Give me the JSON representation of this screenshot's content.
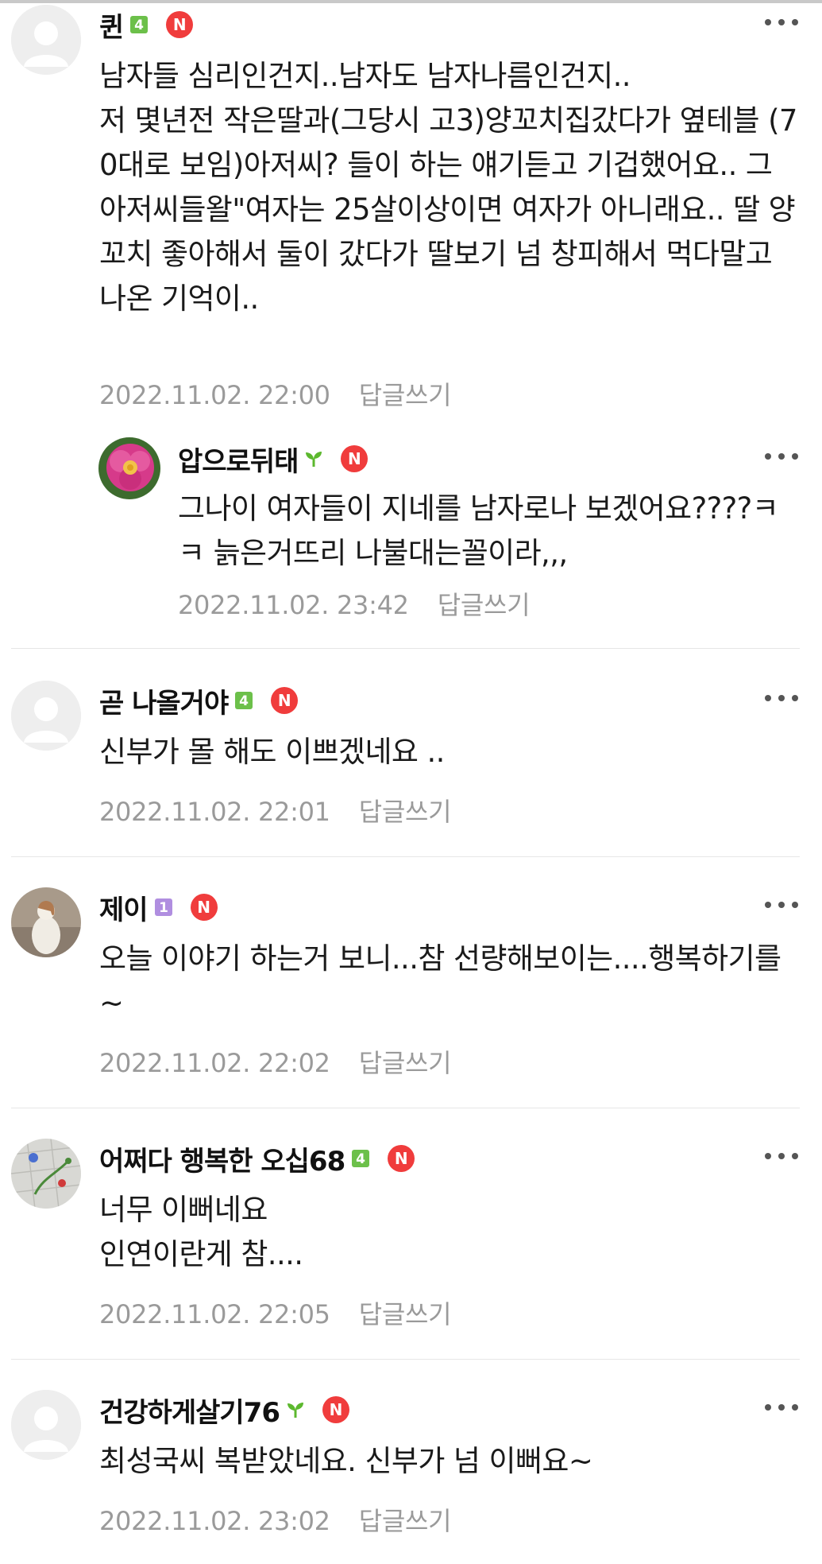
{
  "comments": [
    {
      "nickname": "퀸",
      "level": "4",
      "new_badge": "N",
      "text": "남자들 심리인건지..남자도 남자나름인건지..\n저 몇년전 작은딸과(그당시 고3)양꼬치집갔다가 옆테블 (70대로 보임)아저씨? 들이 하는 얘기듣고 기겁했어요.. 그 아저씨들왈\"여자는 25살이상이면 여자가 아니래요.. 딸 양꼬치 좋아해서 둘이 갔다가 딸보기 넘 창피해서 먹다말고나온 기억이..",
      "timestamp": "2022.11.02. 22:00",
      "reply_label": "답글쓰기",
      "avatar": "default-profile-icon"
    },
    {
      "nickname": "압으로뒤태",
      "level": "sprout",
      "new_badge": "N",
      "text": "그나이 여자들이 지네를 남자로나 보겠어요????ㅋㅋ 늙은거뜨리 나불대는꼴이라,,,",
      "timestamp": "2022.11.02. 23:42",
      "reply_label": "답글쓰기",
      "avatar": "peony-flower-photo"
    },
    {
      "nickname": "곧 나올거야",
      "level": "4",
      "new_badge": "N",
      "text": "신부가 몰 해도 이쁘겠네요 ..",
      "timestamp": "2022.11.02. 22:01",
      "reply_label": "답글쓰기",
      "avatar": "default-profile-icon"
    },
    {
      "nickname": "제이",
      "level": "1",
      "new_badge": "N",
      "text": "오늘 이야기 하는거 보니...참 선량해보이는....행복하기를~",
      "timestamp": "2022.11.02. 22:02",
      "reply_label": "답글쓰기",
      "avatar": "figurine-photo"
    },
    {
      "nickname": "어쩌다 행복한 오십68",
      "level": "4",
      "new_badge": "N",
      "text": "너무 이뻐네요\n인연이란게 참....",
      "timestamp": "2022.11.02. 22:05",
      "reply_label": "답글쓰기",
      "avatar": "flower-pavement-photo"
    },
    {
      "nickname": "건강하게살기76",
      "level": "sprout",
      "new_badge": "N",
      "text": "최성국씨 복받았네요. 신부가 넘 이뻐요~",
      "timestamp": "2022.11.02. 23:02",
      "reply_label": "답글쓰기",
      "avatar": "default-profile-icon"
    }
  ],
  "colors": {
    "new_badge": "#f03c3c",
    "level_green": "#6cc04a",
    "level_purple": "#b08ee0",
    "meta_gray": "#9a9a9a"
  }
}
